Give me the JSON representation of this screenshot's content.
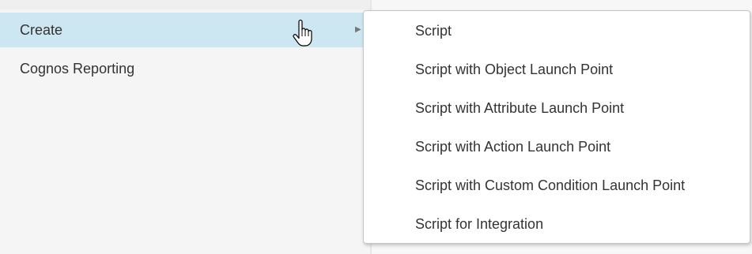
{
  "main_menu": {
    "items": [
      {
        "label": "Create",
        "active": true,
        "has_submenu": true
      },
      {
        "label": "Cognos Reporting",
        "active": false,
        "has_submenu": false
      }
    ],
    "submenu_arrow_icon": "caret-right-icon",
    "active_color": "#cce7f2"
  },
  "submenu": {
    "items": [
      {
        "label": "Script"
      },
      {
        "label": "Script with Object Launch Point"
      },
      {
        "label": "Script with Attribute Launch Point"
      },
      {
        "label": "Script with Action Launch Point"
      },
      {
        "label": "Script with Custom Condition Launch Point"
      },
      {
        "label": "Script for Integration"
      }
    ]
  },
  "cursor": {
    "icon": "hand-pointer-icon"
  }
}
